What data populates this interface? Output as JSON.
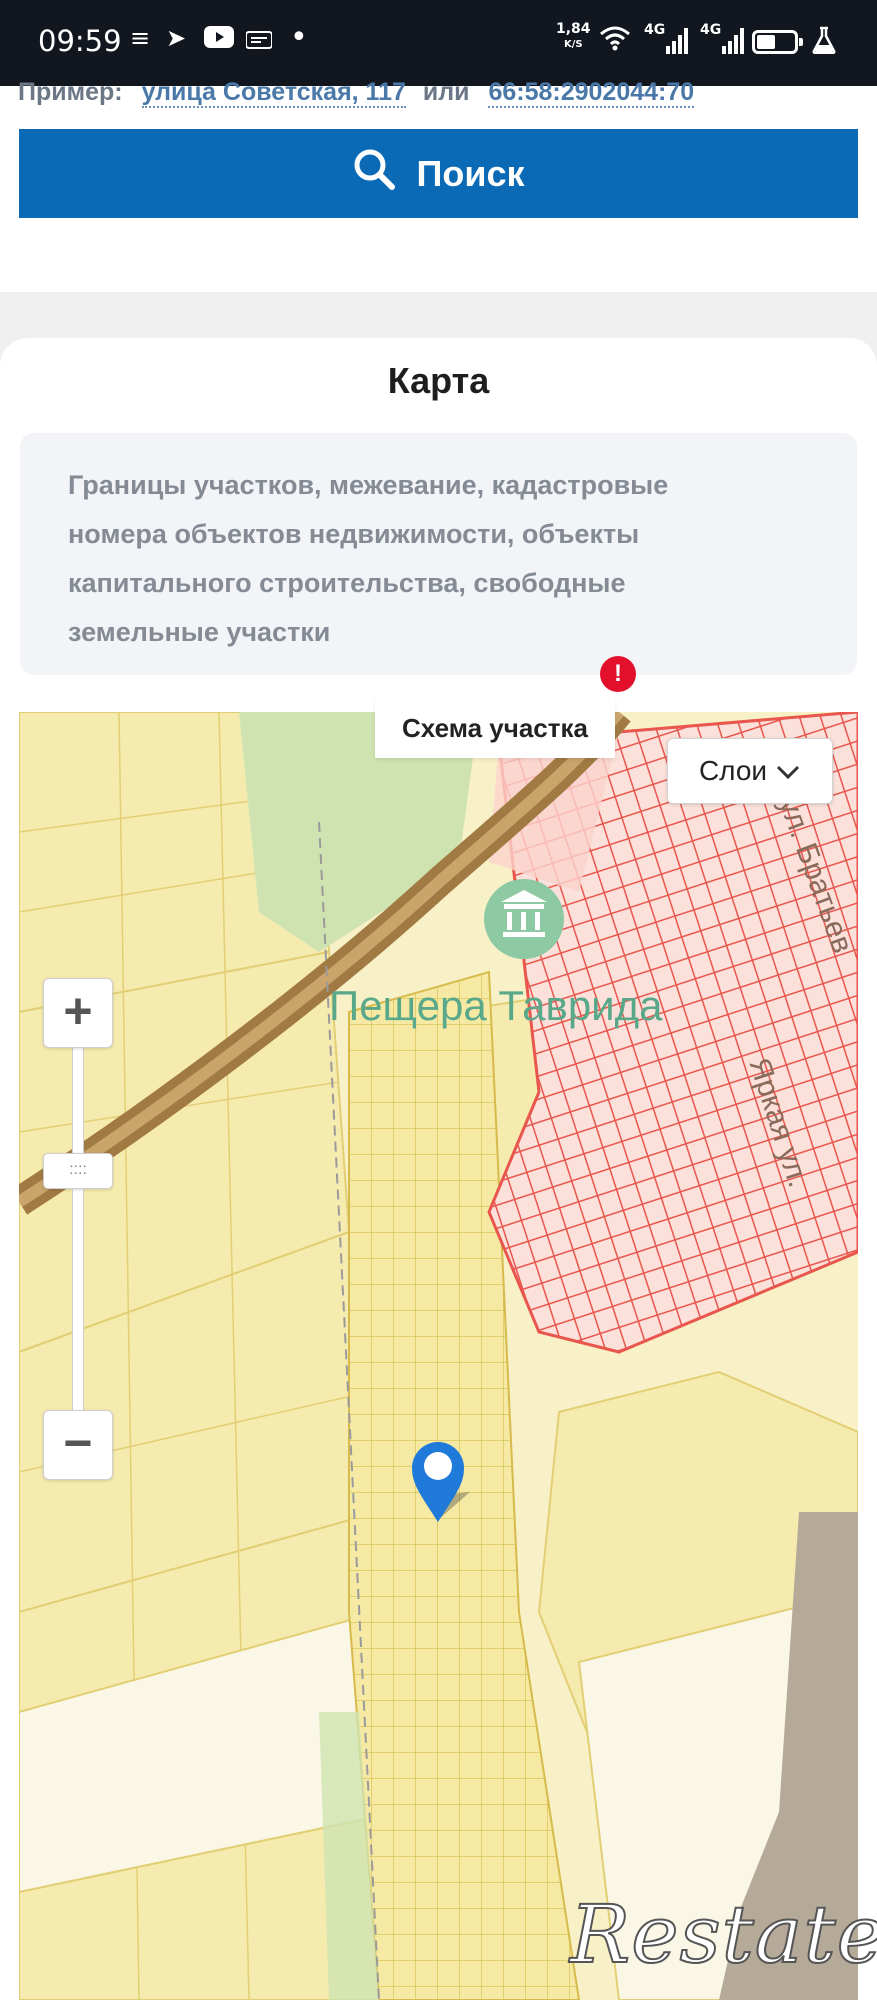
{
  "status_bar": {
    "time": "09:59",
    "speed_value": "1,84",
    "speed_unit": "K/S",
    "net1": "4G",
    "net2": "4G"
  },
  "search": {
    "example_label": "Пример:",
    "example_address": "улица Советская, 117",
    "example_or": "или",
    "example_cadastral": "66:58:2902044:70",
    "button_label": "Поиск"
  },
  "map_section": {
    "title": "Карта",
    "description_lines": [
      "Границы участков, межевание, кадастровые",
      "номера объектов недвижимости, объекты",
      "капитального строительства, свободные",
      "земельные участки"
    ],
    "tab_label": "Схема участка",
    "alert_mark": "!",
    "layers_label": "Слои",
    "zoom_in": "+",
    "zoom_out": "−",
    "place_label": "Пещера Таврида",
    "street_1": "ул. Братьев",
    "street_2": "Яркая ул."
  },
  "watermark": "Restate",
  "icons": {
    "search": "search-icon",
    "layers_chevron": "chevron-down-icon",
    "museum": "museum-icon",
    "pin": "map-pin-icon"
  },
  "colors": {
    "primary": "#0b6ab5",
    "parcel_fill": "#f6ebae",
    "parcel_line": "#e6d36e",
    "urban_parcel": "#e8564d",
    "road": "#a17a43",
    "green": "#cfe3b0",
    "alert": "#e3102b",
    "pin": "#1f7ad9"
  }
}
